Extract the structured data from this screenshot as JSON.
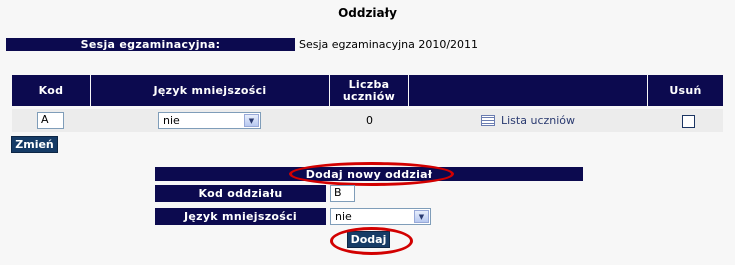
{
  "page": {
    "title": "Oddziały"
  },
  "session": {
    "label": "Sesja egzaminacyjna:",
    "value": "Sesja egzaminacyjna 2010/2011"
  },
  "table": {
    "headers": {
      "kod": "Kod",
      "jezyk": "Język mniejszości",
      "liczba": "Liczba uczniów",
      "usun": "Usuń"
    },
    "rows": [
      {
        "kod": "A",
        "jezyk": "nie",
        "liczba": "0",
        "lista": "Lista uczniów",
        "usun": false
      }
    ]
  },
  "change_button": "Zmień",
  "add_form": {
    "title": "Dodaj nowy oddział",
    "kod_label": "Kod oddziału",
    "kod_value": "B",
    "jezyk_label": "Język mniejszości",
    "jezyk_value": "nie",
    "submit": "Dodaj"
  },
  "colors": {
    "header_bg": "#0c0a4f",
    "button_bg": "#163b66",
    "highlight": "#d20000"
  }
}
